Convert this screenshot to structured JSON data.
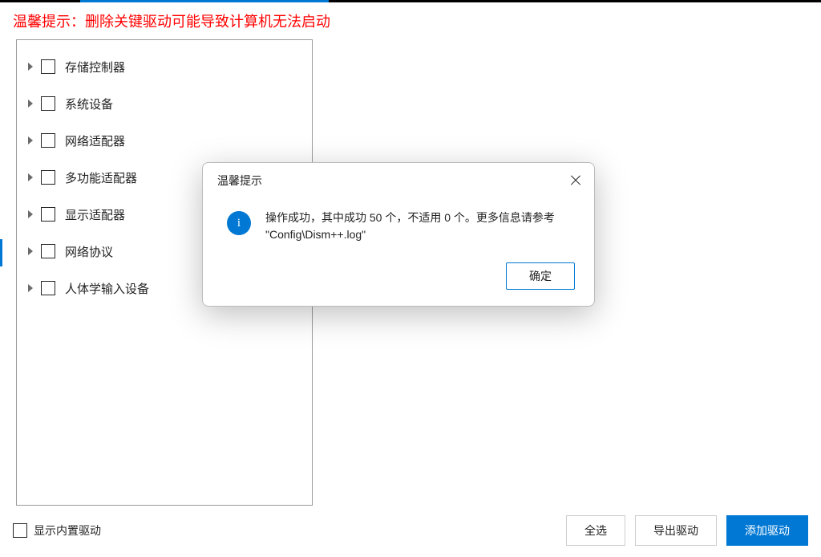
{
  "warning_text": "温馨提示：删除关键驱动可能导致计算机无法启动",
  "tree": {
    "items": [
      {
        "label": "存储控制器"
      },
      {
        "label": "系统设备"
      },
      {
        "label": "网络适配器"
      },
      {
        "label": "多功能适配器"
      },
      {
        "label": "显示适配器"
      },
      {
        "label": "网络协议"
      },
      {
        "label": "人体学输入设备"
      }
    ]
  },
  "show_builtin_label": "显示内置驱动",
  "buttons": {
    "select_all": "全选",
    "export_driver": "导出驱动",
    "add_driver": "添加驱动"
  },
  "modal": {
    "title": "温馨提示",
    "message": "操作成功，其中成功 50 个，不适用 0 个。更多信息请参考 \"Config\\Dism++.log\"",
    "ok": "确定",
    "info_glyph": "i"
  }
}
